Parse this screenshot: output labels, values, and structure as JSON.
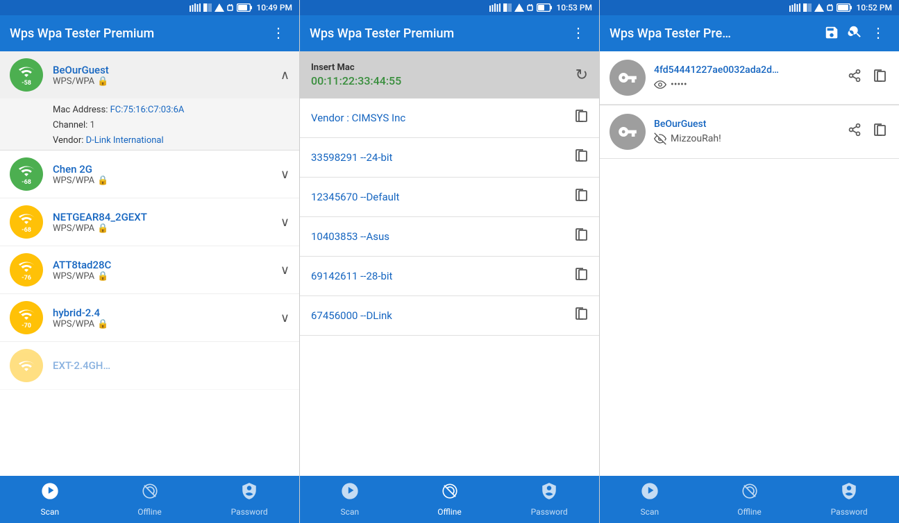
{
  "panel1": {
    "status_bar": {
      "time": "10:49 PM"
    },
    "app_bar": {
      "title": "Wps Wpa Tester Premium",
      "menu_icon": "⋮"
    },
    "wifi_items": [
      {
        "id": "beourguest",
        "name": "BeOurGuest",
        "type": "WPS/WPA",
        "signal": "-58",
        "color": "green",
        "expanded": true,
        "mac": "FC:75:16:C7:03:6A",
        "channel": "1",
        "vendor": "D-Link International"
      },
      {
        "id": "chen2g",
        "name": "Chen 2G",
        "type": "WPS/WPA",
        "signal": "-68",
        "color": "green",
        "expanded": false
      },
      {
        "id": "netgear",
        "name": "NETGEAR84_2GEXT",
        "type": "WPS/WPA",
        "signal": "-68",
        "color": "yellow",
        "expanded": false
      },
      {
        "id": "att",
        "name": "ATT8tad28C",
        "type": "WPS/WPA",
        "signal": "-76",
        "color": "yellow",
        "expanded": false
      },
      {
        "id": "hybrid",
        "name": "hybrid-2.4",
        "type": "WPS/WPA",
        "signal": "-70",
        "color": "yellow",
        "expanded": false
      }
    ],
    "bottom_nav": [
      {
        "id": "scan",
        "label": "Scan",
        "active": true
      },
      {
        "id": "offline",
        "label": "Offline",
        "active": false
      },
      {
        "id": "password",
        "label": "Password",
        "active": false
      }
    ]
  },
  "panel2": {
    "status_bar": {
      "time": "10:53 PM"
    },
    "app_bar": {
      "title": "Wps Wpa Tester Premium",
      "menu_icon": "⋮"
    },
    "mac_input": {
      "label": "Insert Mac",
      "value": "00:11:22:33:44:55"
    },
    "vendor_label": "Vendor : CIMSYS Inc",
    "pin_items": [
      {
        "text": "33598291 --24-bit"
      },
      {
        "text": "12345670 --Default"
      },
      {
        "text": "10403853 --Asus"
      },
      {
        "text": "69142611 --28-bit"
      },
      {
        "text": "67456000 --DLink"
      }
    ],
    "bottom_nav": [
      {
        "id": "scan",
        "label": "Scan",
        "active": false
      },
      {
        "id": "offline",
        "label": "Offline",
        "active": true
      },
      {
        "id": "password",
        "label": "Password",
        "active": false
      }
    ]
  },
  "panel3": {
    "status_bar": {
      "time": "10:52 PM"
    },
    "app_bar": {
      "title": "Wps Wpa Tester Pre…",
      "save_icon": "💾",
      "search_icon": "🔍",
      "menu_icon": "⋮"
    },
    "passwords": [
      {
        "id": "pwd1",
        "name": "4fd54441227ae0032ada2d…",
        "value": "•••••",
        "eye_crossed": false
      },
      {
        "id": "pwd2",
        "name": "BeOurGuest",
        "value": "MizzouRah!",
        "eye_crossed": true
      }
    ],
    "bottom_nav": [
      {
        "id": "scan",
        "label": "Scan",
        "active": false
      },
      {
        "id": "offline",
        "label": "Offline",
        "active": false
      },
      {
        "id": "password",
        "label": "Password",
        "active": false
      }
    ]
  },
  "icons": {
    "lock": "🔒",
    "wifi": "📶",
    "key": "🔑",
    "copy": "⧉",
    "share": "⇧",
    "chevron_up": "∧",
    "chevron_down": "∨",
    "refresh": "↻",
    "scan_label": "Scan",
    "offline_label": "Offline",
    "password_label": "Password"
  }
}
